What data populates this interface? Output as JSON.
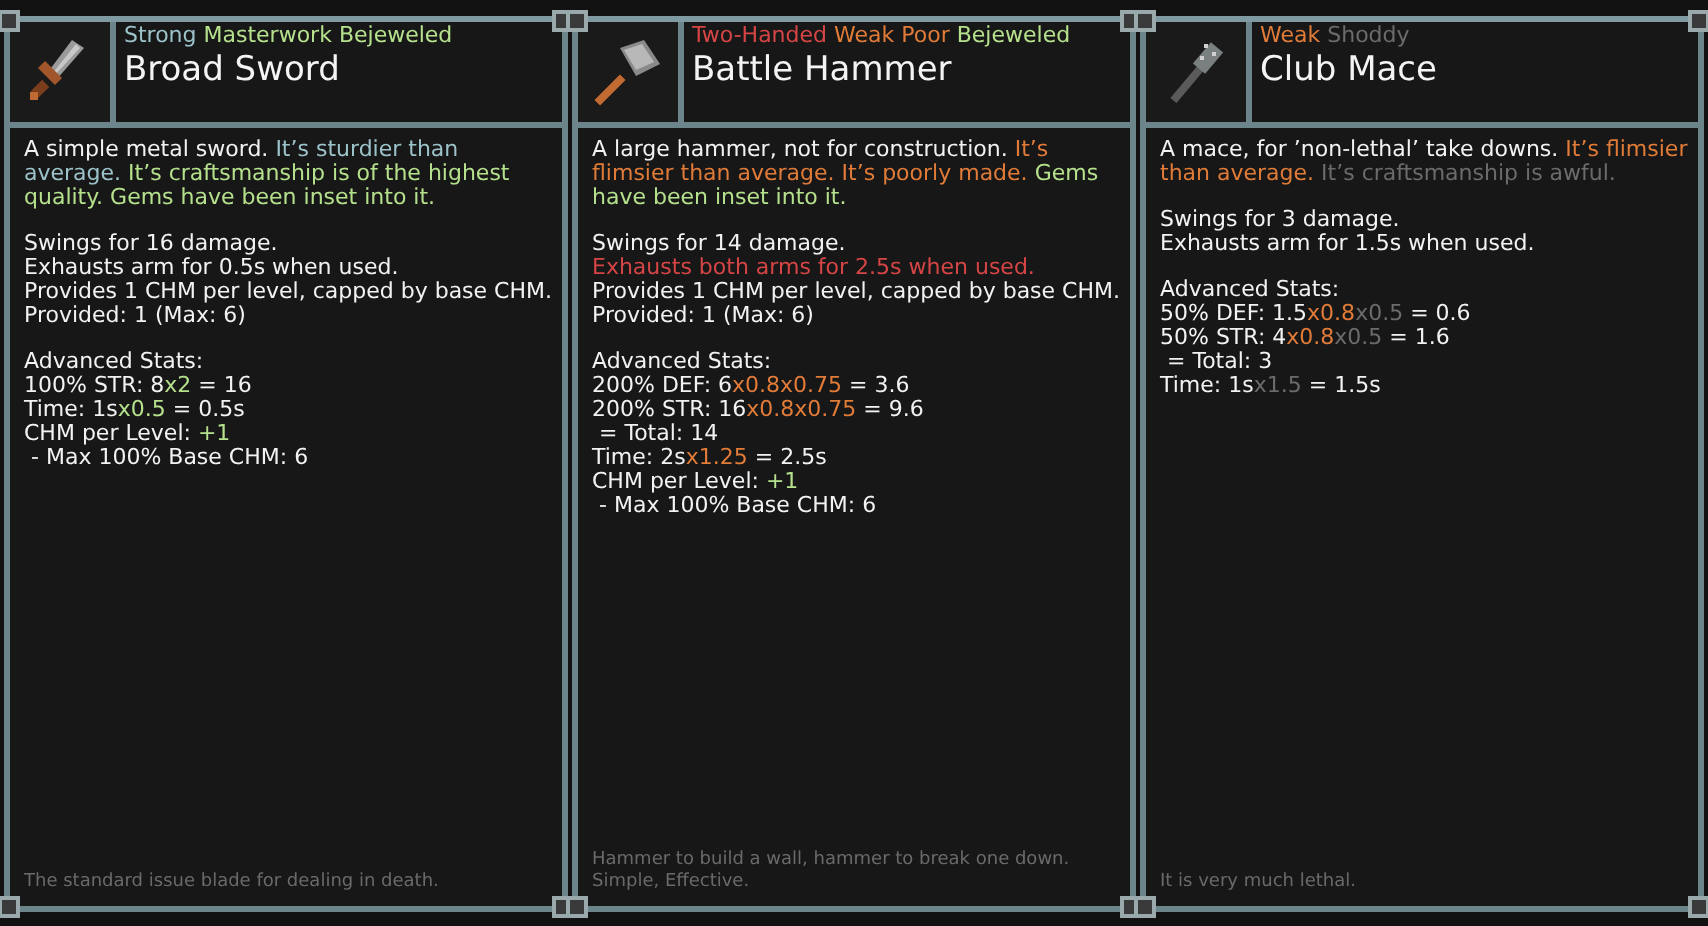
{
  "items": [
    {
      "kind": "sword",
      "quality": [
        {
          "text": "Strong",
          "color": "#9cc3c9"
        },
        {
          "text": "Masterwork Bejeweled",
          "color": "#b5e08c"
        }
      ],
      "name": "Broad Sword",
      "description": [
        {
          "text": "A simple metal sword. ",
          "color": "#f2f2f2"
        },
        {
          "text": "It’s sturdier than average. ",
          "color": "#9cc3c9"
        },
        {
          "text": "It’s craftsmanship is of the highest quality. Gems have been inset into it.",
          "color": "#b5e08c"
        }
      ],
      "effects": [
        [
          {
            "text": "Swings for 16 damage.",
            "color": "#f2f2f2"
          }
        ],
        [
          {
            "text": "Exhausts arm for 0.5s when used.",
            "color": "#f2f2f2"
          }
        ],
        [
          {
            "text": "Provides 1 CHM per level, capped by base CHM. Provided: 1 (Max: 6)",
            "color": "#f2f2f2"
          }
        ]
      ],
      "advanced_title": "Advanced Stats:",
      "stats": [
        [
          {
            "text": "100% STR: 8",
            "color": "#f2f2f2"
          },
          {
            "text": "x2",
            "color": "#b5e08c"
          },
          {
            "text": " = 16",
            "color": "#f2f2f2"
          }
        ],
        [
          {
            "text": "Time: 1s",
            "color": "#f2f2f2"
          },
          {
            "text": "x0.5",
            "color": "#b5e08c"
          },
          {
            "text": " = 0.5s",
            "color": "#f2f2f2"
          }
        ],
        [
          {
            "text": "CHM per Level: ",
            "color": "#f2f2f2"
          },
          {
            "text": "+1",
            "color": "#b5e08c"
          }
        ],
        [
          {
            "text": " - Max 100% Base CHM: 6",
            "color": "#f2f2f2"
          }
        ]
      ],
      "flavor": "The standard issue blade for dealing in death."
    },
    {
      "kind": "hammer",
      "quality": [
        {
          "text": "Two-Handed",
          "color": "#d64545"
        },
        {
          "text": "Weak Poor",
          "color": "#e07b38"
        },
        {
          "text": "Bejeweled",
          "color": "#b5e08c"
        }
      ],
      "name": "Battle Hammer",
      "description": [
        {
          "text": "A large hammer, not for construction. ",
          "color": "#f2f2f2"
        },
        {
          "text": "It’s flimsier than average. It’s poorly made. ",
          "color": "#e07b38"
        },
        {
          "text": "Gems have been inset into it.",
          "color": "#b5e08c"
        }
      ],
      "effects": [
        [
          {
            "text": "Swings for 14 damage.",
            "color": "#f2f2f2"
          }
        ],
        [
          {
            "text": "Exhausts both arms for 2.5s when used.",
            "color": "#d64545"
          }
        ],
        [
          {
            "text": "Provides 1 CHM per level, capped by base CHM. Provided: 1 (Max: 6)",
            "color": "#f2f2f2"
          }
        ]
      ],
      "advanced_title": "Advanced Stats:",
      "stats": [
        [
          {
            "text": "200% DEF: 6",
            "color": "#f2f2f2"
          },
          {
            "text": "x0.8x0.75",
            "color": "#e07b38"
          },
          {
            "text": " = 3.6",
            "color": "#f2f2f2"
          }
        ],
        [
          {
            "text": "200% STR: 16",
            "color": "#f2f2f2"
          },
          {
            "text": "x0.8x0.75",
            "color": "#e07b38"
          },
          {
            "text": " = 9.6",
            "color": "#f2f2f2"
          }
        ],
        [
          {
            "text": " = Total: 14",
            "color": "#f2f2f2"
          }
        ],
        [
          {
            "text": "Time: 2s",
            "color": "#f2f2f2"
          },
          {
            "text": "x1.25",
            "color": "#e07b38"
          },
          {
            "text": " = 2.5s",
            "color": "#f2f2f2"
          }
        ],
        [
          {
            "text": "CHM per Level: ",
            "color": "#f2f2f2"
          },
          {
            "text": "+1",
            "color": "#b5e08c"
          }
        ],
        [
          {
            "text": " - Max 100% Base CHM: 6",
            "color": "#f2f2f2"
          }
        ]
      ],
      "flavor": "Hammer to build a wall, hammer to break one down. Simple, Effective."
    },
    {
      "kind": "mace",
      "quality": [
        {
          "text": "Weak",
          "color": "#e07b38"
        },
        {
          "text": "Shoddy",
          "color": "#6b6b6b"
        }
      ],
      "name": "Club Mace",
      "description": [
        {
          "text": "A mace, for ’non-lethal’ take downs. ",
          "color": "#f2f2f2"
        },
        {
          "text": "It’s flimsier than average. ",
          "color": "#e07b38"
        },
        {
          "text": "It’s craftsmanship is awful.",
          "color": "#6b6b6b"
        }
      ],
      "effects": [
        [
          {
            "text": "Swings for 3 damage.",
            "color": "#f2f2f2"
          }
        ],
        [
          {
            "text": "Exhausts arm for 1.5s when used.",
            "color": "#f2f2f2"
          }
        ]
      ],
      "advanced_title": "Advanced Stats:",
      "stats": [
        [
          {
            "text": "50% DEF: 1.5",
            "color": "#f2f2f2"
          },
          {
            "text": "x0.8",
            "color": "#e07b38"
          },
          {
            "text": "x0.5",
            "color": "#6b6b6b"
          },
          {
            "text": " = 0.6",
            "color": "#f2f2f2"
          }
        ],
        [
          {
            "text": "50% STR: 4",
            "color": "#f2f2f2"
          },
          {
            "text": "x0.8",
            "color": "#e07b38"
          },
          {
            "text": "x0.5",
            "color": "#6b6b6b"
          },
          {
            "text": " = 1.6",
            "color": "#f2f2f2"
          }
        ],
        [
          {
            "text": " = Total: 3",
            "color": "#f2f2f2"
          }
        ],
        [
          {
            "text": "Time: 1s",
            "color": "#f2f2f2"
          },
          {
            "text": "x1.5",
            "color": "#6b6b6b"
          },
          {
            "text": " = 1.5s",
            "color": "#f2f2f2"
          }
        ]
      ],
      "flavor": "It is very much lethal."
    }
  ]
}
